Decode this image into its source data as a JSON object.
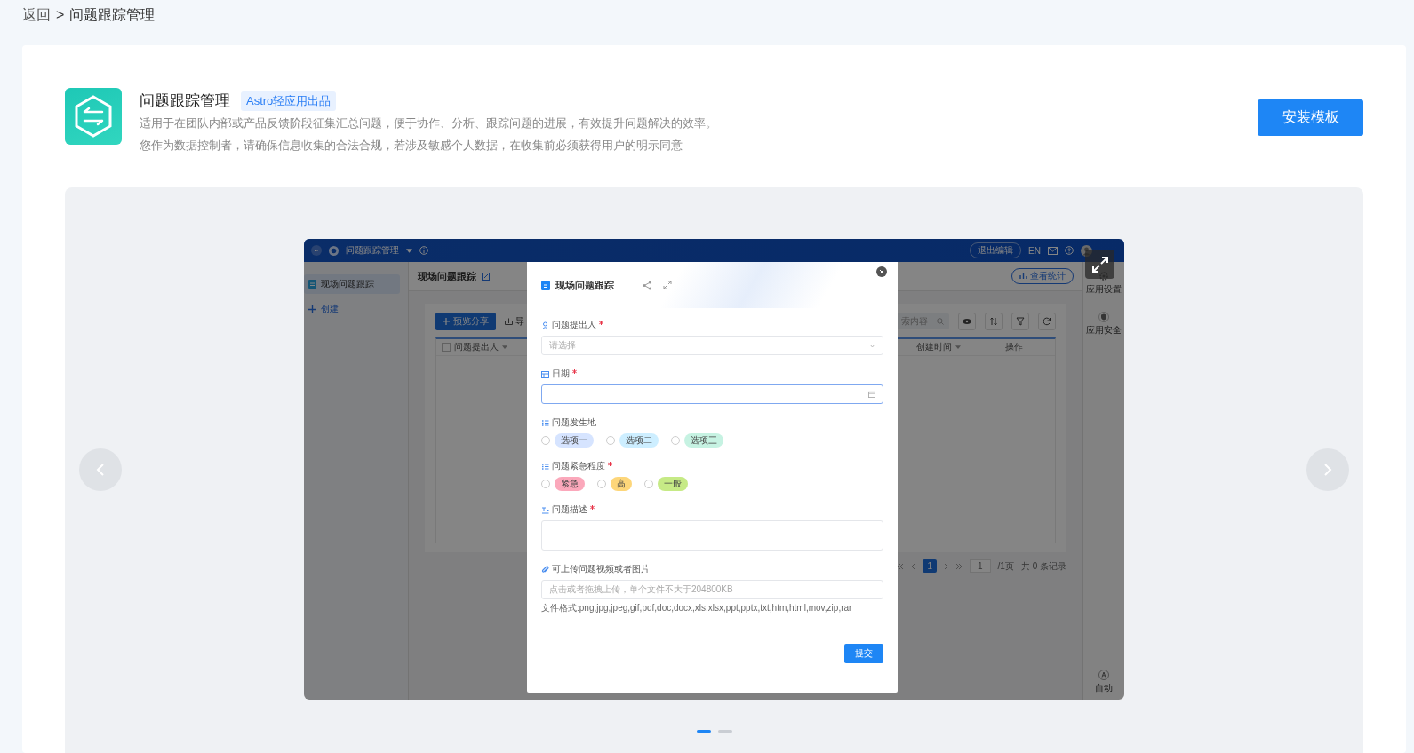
{
  "breadcrumb": {
    "back": "返回",
    "separator": ">",
    "current": "问题跟踪管理"
  },
  "template": {
    "title": "问题跟踪管理",
    "badge": "Astro轻应用出品",
    "description": [
      "适用于在团队内部或产品反馈阶段征集汇总问题，便于协作、分析、跟踪问题的进展，有效提升问题解决的效率。",
      "您作为数据控制者，请确保信息收集的合法合规，若涉及敏感个人数据，在收集前必须获得用户的明示同意"
    ],
    "install_button": "安装模板"
  },
  "preview": {
    "top_bar": {
      "app_name": "问题跟踪管理",
      "exit_button": "退出编辑",
      "language": "EN"
    },
    "sidebar": {
      "items": [
        {
          "kind": "page",
          "label": "现场问题跟踪",
          "selected": true
        },
        {
          "kind": "create",
          "label": "创建",
          "selected": false
        }
      ]
    },
    "page_title": "现场问题跟踪",
    "stats_button": "查看统计",
    "toolbar": {
      "share_button": "预览分享",
      "import_button": "导",
      "search_placeholder": "索内容"
    },
    "table": {
      "select_all_checked": false,
      "columns": [
        "问题提出人",
        "创建时间",
        "操作"
      ]
    },
    "pagination": {
      "current_page": "1",
      "page_input": "1",
      "total_pages": "/1页",
      "total_records": "共 0 条记录"
    },
    "right_panel": [
      {
        "kind": "settings",
        "label": "应用设置"
      },
      {
        "kind": "security",
        "label": "应用安全"
      },
      {
        "kind": "automation",
        "label": "自动"
      }
    ],
    "form": {
      "title": "现场问题跟踪",
      "fields": [
        {
          "kind": "select",
          "label": "问题提出人",
          "required": true,
          "placeholder": "请选择"
        },
        {
          "kind": "date",
          "label": "日期",
          "required": true,
          "focused": true
        },
        {
          "kind": "radio",
          "label": "问题发生地",
          "required": false,
          "options": [
            {
              "label": "选项一",
              "color": "#d6e4ff",
              "selected": false
            },
            {
              "label": "选项二",
              "color": "#cdeeff",
              "selected": false
            },
            {
              "label": "选项三",
              "color": "#c6f2e2",
              "selected": false
            }
          ]
        },
        {
          "kind": "radio",
          "label": "问题紧急程度",
          "required": true,
          "options": [
            {
              "label": "紧急",
              "color": "#fba8bb",
              "selected": false
            },
            {
              "label": "高",
              "color": "#fdd67a",
              "selected": false
            },
            {
              "label": "一般",
              "color": "#c6ea86",
              "selected": false
            }
          ]
        },
        {
          "kind": "textarea",
          "label": "问题描述",
          "required": true
        },
        {
          "kind": "upload",
          "label": "可上传问题视频或者图片",
          "required": false,
          "placeholder": "点击或者拖拽上传，单个文件不大于204800KB",
          "hint": "文件格式:png,jpg,jpeg,gif,pdf,doc,docx,xls,xlsx,ppt,pptx,txt,htm,html,mov,zip,rar"
        }
      ],
      "submit": "提交"
    }
  },
  "carousel": {
    "slides": [
      {
        "selected": true
      },
      {
        "selected": false
      }
    ]
  }
}
